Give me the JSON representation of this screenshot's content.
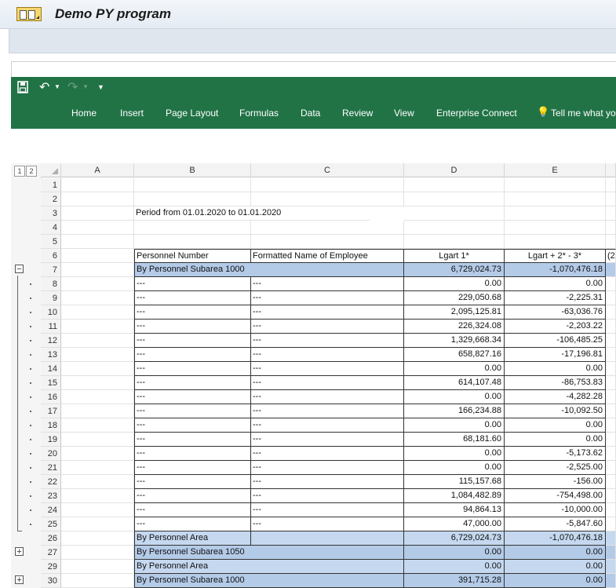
{
  "window": {
    "title": "Demo PY program",
    "app_icon": "hierarchy-icon"
  },
  "excel": {
    "quick_access": {
      "save_icon": "save-icon",
      "undo_icon": "undo-icon",
      "redo_icon": "redo-icon",
      "customize_icon": "customize-icon"
    },
    "tabs": [
      "Home",
      "Insert",
      "Page Layout",
      "Formulas",
      "Data",
      "Review",
      "View",
      "Enterprise Connect",
      "Tell me what yo"
    ],
    "outline_levels": [
      "1",
      "2"
    ],
    "columns": [
      "A",
      "B",
      "C",
      "D",
      "E"
    ],
    "accent": "#217346"
  },
  "sheet": {
    "period": "Period from 01.01.2020 to 01.01.2020",
    "headers": [
      "Personnel Number",
      "Formatted Name of Employee",
      "Lgart 1*",
      "Lgart + 2* - 3*",
      "(2"
    ],
    "subarea_1000": {
      "label": "By Personnel Subarea 1000",
      "d": "6,729,024.73",
      "e": "-1,070,476.18"
    },
    "detail_rows": [
      {
        "b": "---",
        "c": "---",
        "d": "0.00",
        "e": "0.00"
      },
      {
        "b": "---",
        "c": "---",
        "d": "229,050.68",
        "e": "-2,225.31"
      },
      {
        "b": "---",
        "c": "---",
        "d": "2,095,125.81",
        "e": "-63,036.76"
      },
      {
        "b": "---",
        "c": "---",
        "d": "226,324.08",
        "e": "-2,203.22"
      },
      {
        "b": "---",
        "c": "---",
        "d": "1,329,668.34",
        "e": "-106,485.25"
      },
      {
        "b": "---",
        "c": "---",
        "d": "658,827.16",
        "e": "-17,196.81"
      },
      {
        "b": "---",
        "c": "---",
        "d": "0.00",
        "e": "0.00"
      },
      {
        "b": "---",
        "c": "---",
        "d": "614,107.48",
        "e": "-86,753.83"
      },
      {
        "b": "---",
        "c": "---",
        "d": "0.00",
        "e": "-4,282.28"
      },
      {
        "b": "---",
        "c": "---",
        "d": "166,234.88",
        "e": "-10,092.50"
      },
      {
        "b": "---",
        "c": "---",
        "d": "0.00",
        "e": "0.00"
      },
      {
        "b": "---",
        "c": "---",
        "d": "68,181.60",
        "e": "0.00"
      },
      {
        "b": "---",
        "c": "---",
        "d": "0.00",
        "e": "-5,173.62"
      },
      {
        "b": "---",
        "c": "---",
        "d": "0.00",
        "e": "-2,525.00"
      },
      {
        "b": "---",
        "c": "---",
        "d": "115,157.68",
        "e": "-156.00"
      },
      {
        "b": "---",
        "c": "---",
        "d": "1,084,482.89",
        "e": "-754,498.00"
      },
      {
        "b": "---",
        "c": "---",
        "d": "94,864.13",
        "e": "-10,000.00"
      },
      {
        "b": "---",
        "c": "---",
        "d": "47,000.00",
        "e": "-5,847.60"
      }
    ],
    "summary_rows": [
      {
        "label": "By Personnel Area",
        "d": "6,729,024.73",
        "e": "-1,070,476.18"
      },
      {
        "label": "By Personnel Subarea 1050",
        "d": "0.00",
        "e": "0.00"
      },
      {
        "label": "By Personnel Area",
        "d": "0.00",
        "e": "0.00"
      },
      {
        "label": "By Personnel Subarea 1000",
        "d": "391,715.28",
        "e": "0.00"
      }
    ],
    "row_numbers": [
      "1",
      "2",
      "3",
      "4",
      "5",
      "6",
      "7",
      "8",
      "9",
      "10",
      "11",
      "12",
      "13",
      "14",
      "15",
      "16",
      "17",
      "18",
      "19",
      "20",
      "21",
      "22",
      "23",
      "24",
      "25",
      "26",
      "27",
      "29",
      "30"
    ],
    "outline_buttons": {
      "minus": "−",
      "plus": "+"
    }
  }
}
